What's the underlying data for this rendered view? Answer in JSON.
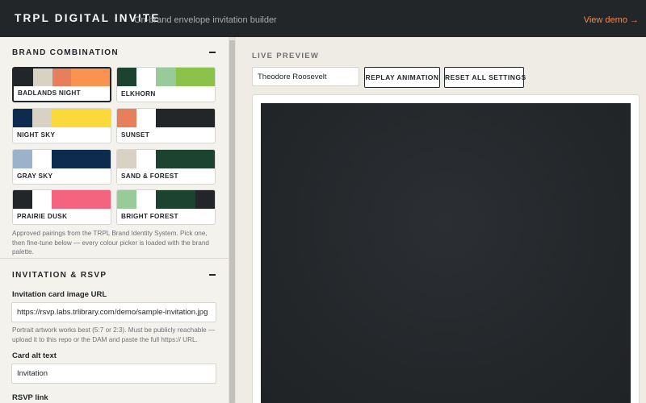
{
  "header": {
    "title": "TRPL DIGITAL INVITE",
    "subtitle": "On-brand envelope invitation builder",
    "view_demo": "View demo →"
  },
  "sidebar": {
    "brand": {
      "heading": "BRAND COMBINATION",
      "selected": "BADLANDS NIGHT",
      "swatches": [
        {
          "label": "BADLANDS NIGHT",
          "colors": [
            "#232629",
            "#d8d2c4",
            "#e87f5c",
            "#fa9250"
          ]
        },
        {
          "label": "ELKHORN",
          "colors": [
            "#1c4330",
            "#ffffff",
            "#99ca99",
            "#8bc34a"
          ]
        },
        {
          "label": "NIGHT SKY",
          "colors": [
            "#0d2a4f",
            "#d8d2c4",
            "#fcd93a"
          ]
        },
        {
          "label": "SUNSET",
          "colors": [
            "#e87f5c",
            "#ffffff",
            "#232629"
          ]
        },
        {
          "label": "GRAY SKY",
          "colors": [
            "#9cb2ca",
            "#ffffff",
            "#0d2a4f"
          ]
        },
        {
          "label": "SAND & FOREST",
          "colors": [
            "#d8d2c4",
            "#ffffff",
            "#1c4330"
          ]
        },
        {
          "label": "PRAIRIE DUSK",
          "colors": [
            "#232629",
            "#ffffff",
            "#f4647e"
          ]
        },
        {
          "label": "BRIGHT FOREST",
          "colors": [
            "#99ca99",
            "#ffffff",
            "#1c4330",
            "#232629"
          ]
        }
      ],
      "note": "Approved pairings from the TRPL Brand Identity System. Pick one, then fine-tune below — every colour picker is loaded with the brand palette."
    },
    "invitation": {
      "heading": "INVITATION & RSVP",
      "image_url_label": "Invitation card image URL",
      "image_url_value": "https://rsvp.labs.trlibrary.com/demo/sample-invitation.jpg",
      "image_url_note": "Portrait artwork works best (5:7 or 2:3). Must be publicly reachable — upload it to this repo or the DAM and paste the full https:// URL.",
      "alt_label": "Card alt text",
      "alt_value": "Invitation",
      "rsvp_label": "RSVP link"
    }
  },
  "preview": {
    "title": "LIVE PREVIEW",
    "guest_name": "Theodore Roosevelt",
    "replay_label": "REPLAY ANIMATION",
    "reset_label": "RESET ALL SETTINGS",
    "stage_color": "#232629"
  },
  "colors": {
    "topbar": "#232629",
    "accent": "#f08a4b",
    "sidebar_bg": "#f4f2ed",
    "page_bg": "#efece6"
  }
}
